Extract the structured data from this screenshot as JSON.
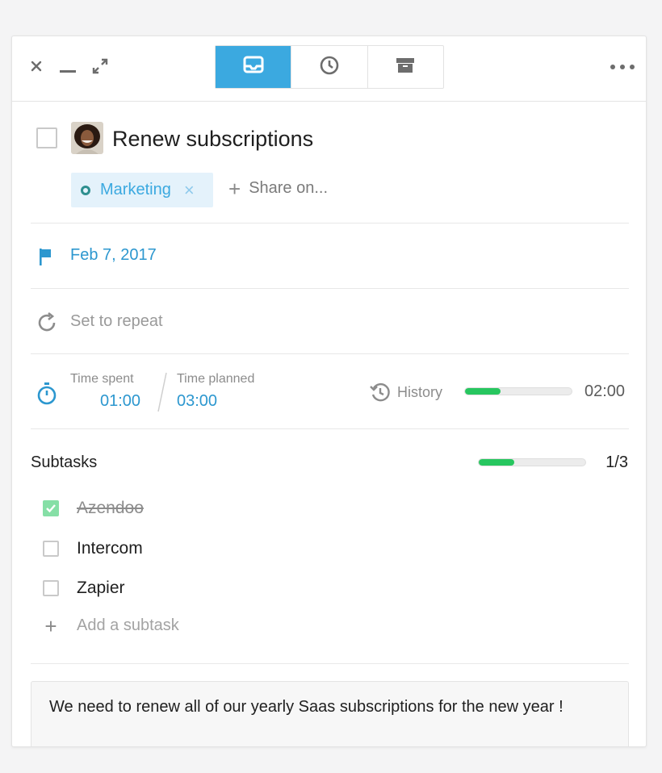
{
  "toolbar": {
    "close_icon": "close-icon",
    "minimize_icon": "minimize-icon",
    "expand_icon": "expand-icon",
    "more_icon": "more-icon",
    "tabs": [
      {
        "icon": "inbox-icon",
        "active": true
      },
      {
        "icon": "clock-icon",
        "active": false
      },
      {
        "icon": "archive-icon",
        "active": false
      }
    ]
  },
  "task": {
    "title": "Renew subscriptions",
    "completed": false,
    "tag": {
      "label": "Marketing",
      "remove": "×"
    },
    "share_label": "Share on...",
    "share_plus": "+",
    "due_date": "Feb 7, 2017",
    "repeat_label": "Set to repeat"
  },
  "time": {
    "spent_label": "Time spent",
    "spent_value": "01:00",
    "planned_label": "Time planned",
    "planned_value": "03:00",
    "history_label": "History",
    "history_value": "02:00",
    "history_progress": 0.33
  },
  "subtasks": {
    "title": "Subtasks",
    "count": "1/3",
    "progress": 0.33,
    "items": [
      {
        "label": "Azendoo",
        "done": true
      },
      {
        "label": "Intercom",
        "done": false
      },
      {
        "label": "Zapier",
        "done": false
      }
    ],
    "add_label": "Add a subtask",
    "add_plus": "+"
  },
  "note": "We need to renew all of our yearly Saas subscriptions for the new year !",
  "colors": {
    "accent": "#3ba9e0",
    "link": "#2c97cf",
    "progress": "#27c65f",
    "tag_bg": "#e4f2fb",
    "done_check": "#86dfa6"
  }
}
